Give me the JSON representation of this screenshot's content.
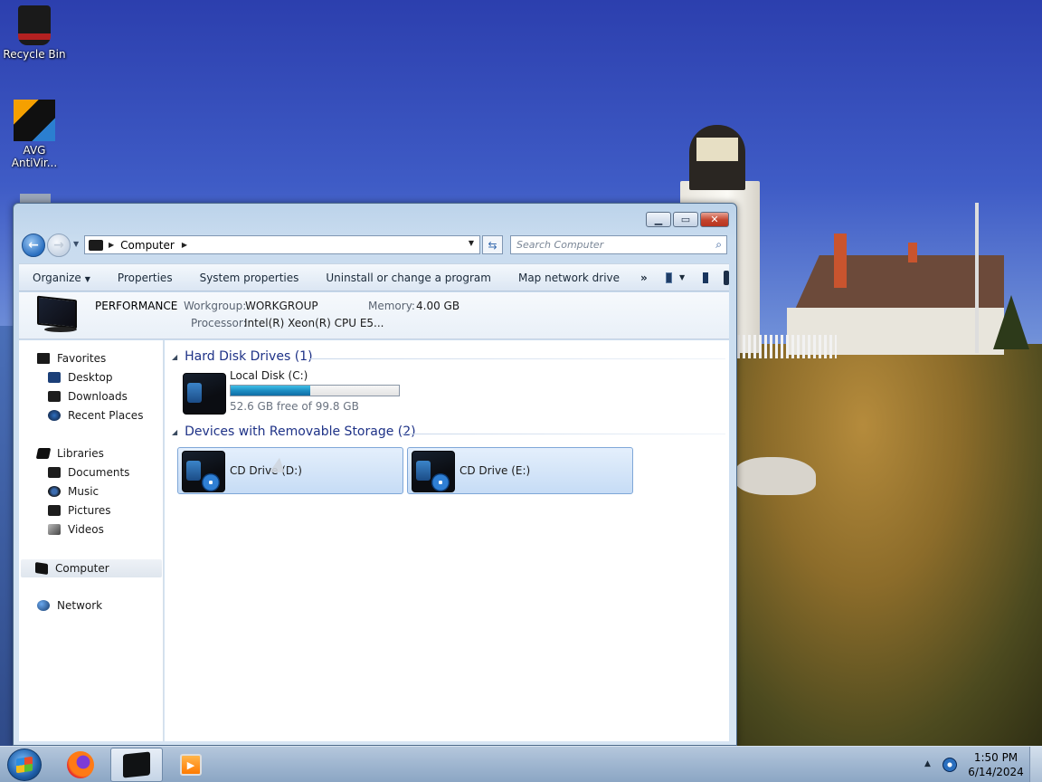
{
  "desktop": {
    "icons": [
      {
        "label": "Recycle Bin"
      },
      {
        "label": "AVG\nAntiVir..."
      }
    ]
  },
  "window": {
    "address": {
      "segment": "Computer"
    },
    "search": {
      "placeholder": "Search Computer"
    },
    "toolbar": {
      "organize": "Organize",
      "properties": "Properties",
      "system_properties": "System properties",
      "uninstall": "Uninstall or change a program",
      "map_network_drive": "Map network drive",
      "more": "»"
    },
    "details": {
      "computer_name": "PERFORMANCE",
      "workgroup_label": "Workgroup:",
      "workgroup_value": "WORKGROUP",
      "memory_label": "Memory:",
      "memory_value": "4.00 GB",
      "processor_label": "Processor:",
      "processor_value": "Intel(R) Xeon(R) CPU E5..."
    },
    "nav": {
      "favorites": "Favorites",
      "desktop": "Desktop",
      "downloads": "Downloads",
      "recent_places": "Recent Places",
      "libraries": "Libraries",
      "documents": "Documents",
      "music": "Music",
      "pictures": "Pictures",
      "videos": "Videos",
      "computer": "Computer",
      "network": "Network"
    },
    "content": {
      "hard_disk_group": "Hard Disk Drives (1)",
      "removable_group": "Devices with Removable Storage (2)",
      "local_disk": {
        "name": "Local Disk (C:)",
        "free_text": "52.6 GB free of 99.8 GB",
        "used_fraction": 0.473
      },
      "cd_drive_d": "CD Drive (D:)",
      "cd_drive_e": "CD Drive (E:)"
    }
  },
  "taskbar": {
    "clock_time": "1:50 PM",
    "clock_date": "6/14/2024"
  }
}
